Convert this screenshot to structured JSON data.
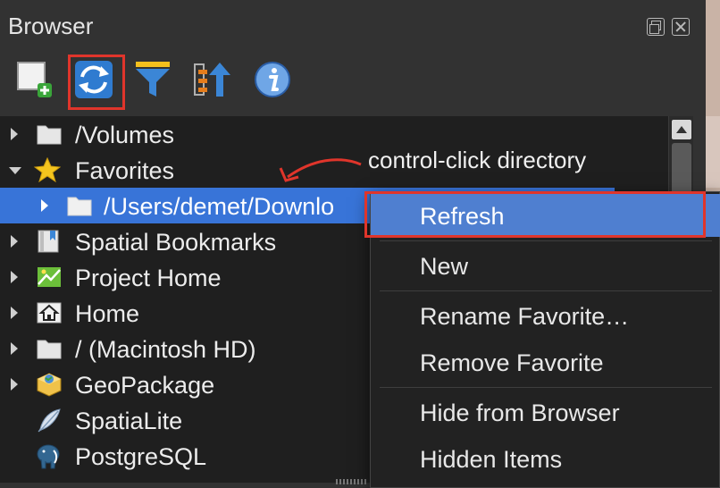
{
  "panel": {
    "title": "Browser"
  },
  "toolbar": {
    "tools": [
      {
        "name": "add-layer-icon"
      },
      {
        "name": "refresh-icon"
      },
      {
        "name": "filter-icon"
      },
      {
        "name": "collapse-all-icon"
      },
      {
        "name": "info-icon"
      }
    ]
  },
  "tree": {
    "items": [
      {
        "label": "/Volumes",
        "icon": "folder-icon"
      },
      {
        "label": "Favorites",
        "icon": "star-icon"
      },
      {
        "label": "/Users/demet/Downlo",
        "icon": "folder-icon"
      },
      {
        "label": "Spatial Bookmarks",
        "icon": "bookmark-icon"
      },
      {
        "label": "Project Home",
        "icon": "project-home-icon"
      },
      {
        "label": "Home",
        "icon": "home-icon"
      },
      {
        "label": "/ (Macintosh HD)",
        "icon": "folder-icon"
      },
      {
        "label": "GeoPackage",
        "icon": "geopackage-icon"
      },
      {
        "label": "SpatiaLite",
        "icon": "feather-icon"
      },
      {
        "label": "PostgreSQL",
        "icon": "elephant-icon"
      }
    ]
  },
  "annotation": {
    "text": "control-click directory"
  },
  "context_menu": {
    "items": [
      {
        "label": "Refresh"
      },
      {
        "label": "New"
      },
      {
        "label": "Rename Favorite…"
      },
      {
        "label": "Remove Favorite"
      },
      {
        "label": "Hide from Browser"
      },
      {
        "label": "Hidden Items"
      }
    ]
  },
  "colors": {
    "selection": "#3874d8",
    "menu_highlight": "#4f7fd0",
    "callout": "#e0352b"
  }
}
